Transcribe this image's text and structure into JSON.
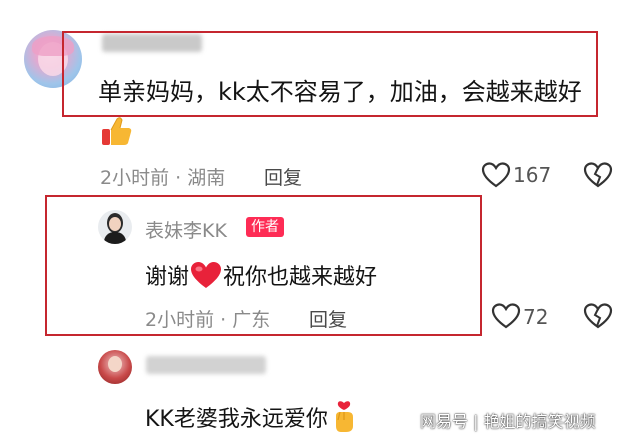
{
  "comments": [
    {
      "text": "单亲妈妈，kk太不容易了，加油，会越来越好",
      "emoji": "thumbs-up",
      "time_location": "2小时前 · 湖南",
      "reply_label": "回复",
      "likes": "167"
    }
  ],
  "reply": {
    "username": "表妹李KK",
    "author_tag": "作者",
    "text_before": "谢谢",
    "text_after": "祝你也越来越好",
    "time_location": "2小时前 · 广东",
    "reply_label": "回复",
    "likes": "72"
  },
  "third_comment": {
    "text": "KK老婆我永远爱你"
  },
  "watermark": "网易号 | 艳姐的搞笑视频",
  "colors": {
    "highlight_box": "#c5262f",
    "author_tag": "#fe2c55",
    "heart_emoji": "#e8223a"
  }
}
